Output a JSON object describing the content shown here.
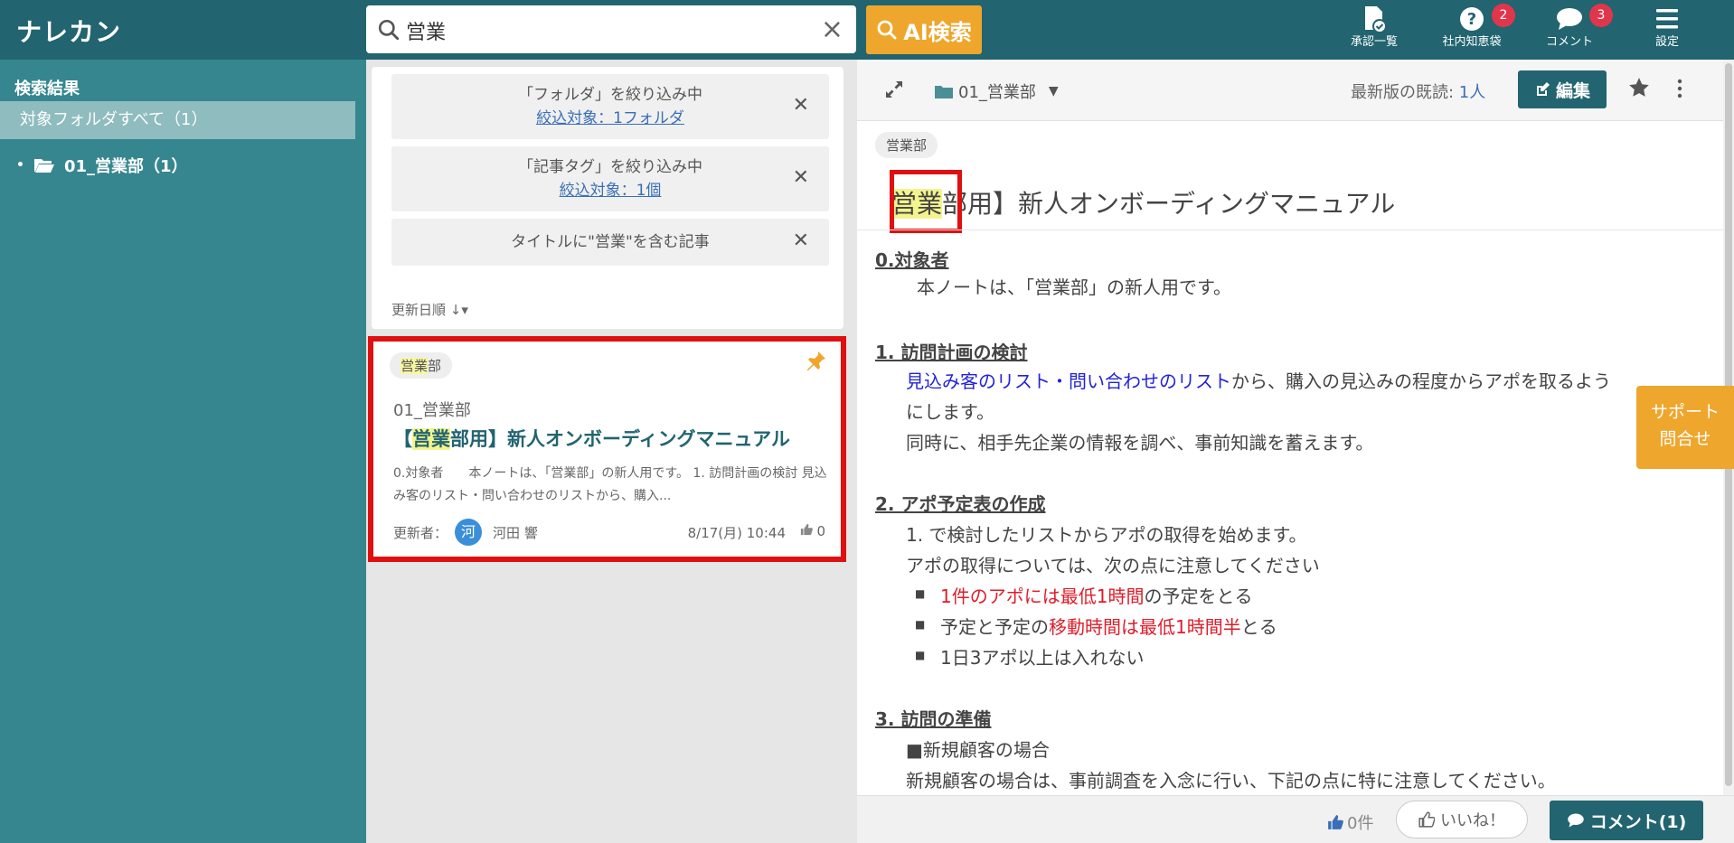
{
  "app": {
    "logo": "ナレカン"
  },
  "search": {
    "query": "営業",
    "clear": "×",
    "ai_button": "AI検索"
  },
  "nav": [
    {
      "label": "承認一覧",
      "icon": "approval-doc-icon"
    },
    {
      "label": "社内知恵袋",
      "icon": "question-icon",
      "badge": "2"
    },
    {
      "label": "コメント",
      "icon": "comment-icon",
      "badge": "3"
    },
    {
      "label": "設定",
      "icon": "menu-icon"
    }
  ],
  "sidebar": {
    "title": "検索結果",
    "all_folders": "対象フォルダすべて（1）",
    "folder": "01_営業部（1）"
  },
  "filters": [
    {
      "line1": "「フォルダ」を絞り込み中",
      "line2": "絞込対象：1フォルダ"
    },
    {
      "line1": "「記事タグ」を絞り込み中",
      "line2": "絞込対象：1個"
    },
    {
      "line1": "タイトルに\"営業\"を含む記事"
    }
  ],
  "filter_close": "✕",
  "sort": {
    "label": "更新日順"
  },
  "result_card": {
    "tag_highlight": "営業",
    "tag_rest": "部",
    "folder": "01_営業部",
    "title_pre": "【",
    "title_highlight": "営業",
    "title_post": "部用】新人オンボーディングマニュアル",
    "excerpt": "0.対象者　　本ノートは、「営業部」の新人用です。 1. 訪問計画の検討 見込み客のリスト・問い合わせのリストから、購入...",
    "updater_label": "更新者：",
    "avatar": "河",
    "updater_name": "河田 響",
    "date": "8/17(月) 10:44",
    "likes": "0"
  },
  "article": {
    "breadcrumb": "01_営業部",
    "reads_label": "最新版の既読: ",
    "reads_value": "1人",
    "edit_label": "編集",
    "tag": "営業部",
    "title_highlight": "営業",
    "title_rest": "部用】新人オンボーディングマニュアル",
    "sec0": "0.対象者",
    "sec0_text": "本ノートは、「営業部」の新人用です。",
    "sec1": "1. 訪問計画の検討",
    "sec1_link": "見込み客のリスト・問い合わせのリスト",
    "sec1_text1": "から、購入の見込みの程度からアポを取るよう",
    "sec1_text2": "にします。",
    "sec1_text3": "同時に、相手先企業の情報を調べ、事前知識を蓄えます。",
    "sec2": "2. アポ予定表の作成",
    "sec2_text1": "1. で検討したリストからアポの取得を始めます。",
    "sec2_text2": "アポの取得については、次の点に注意してください",
    "b1_red": "1件のアポには最低1時間",
    "b1_rest": "の予定をとる",
    "b2_pre": "予定と予定の",
    "b2_red": "移動時間は最低1時間半",
    "b2_rest": "とる",
    "b3": "1日3アポ以上は入れない",
    "sec3": "3. 訪問の準備",
    "sec3_text1": "■新規顧客の場合",
    "sec3_text2": "新規顧客の場合は、事前調査を入念に行い、下記の点に特に注意してください。"
  },
  "support": {
    "line1": "サポート",
    "line2": "問合せ"
  },
  "footer": {
    "like_count": "0件",
    "like_button": "いいね！",
    "comment_button": "コメント(1)"
  },
  "colors": {
    "header": "#226470",
    "sidebar": "#36868f",
    "accent": "#eea62c",
    "highlight_box": "#e01010",
    "badge": "#e0364b"
  }
}
